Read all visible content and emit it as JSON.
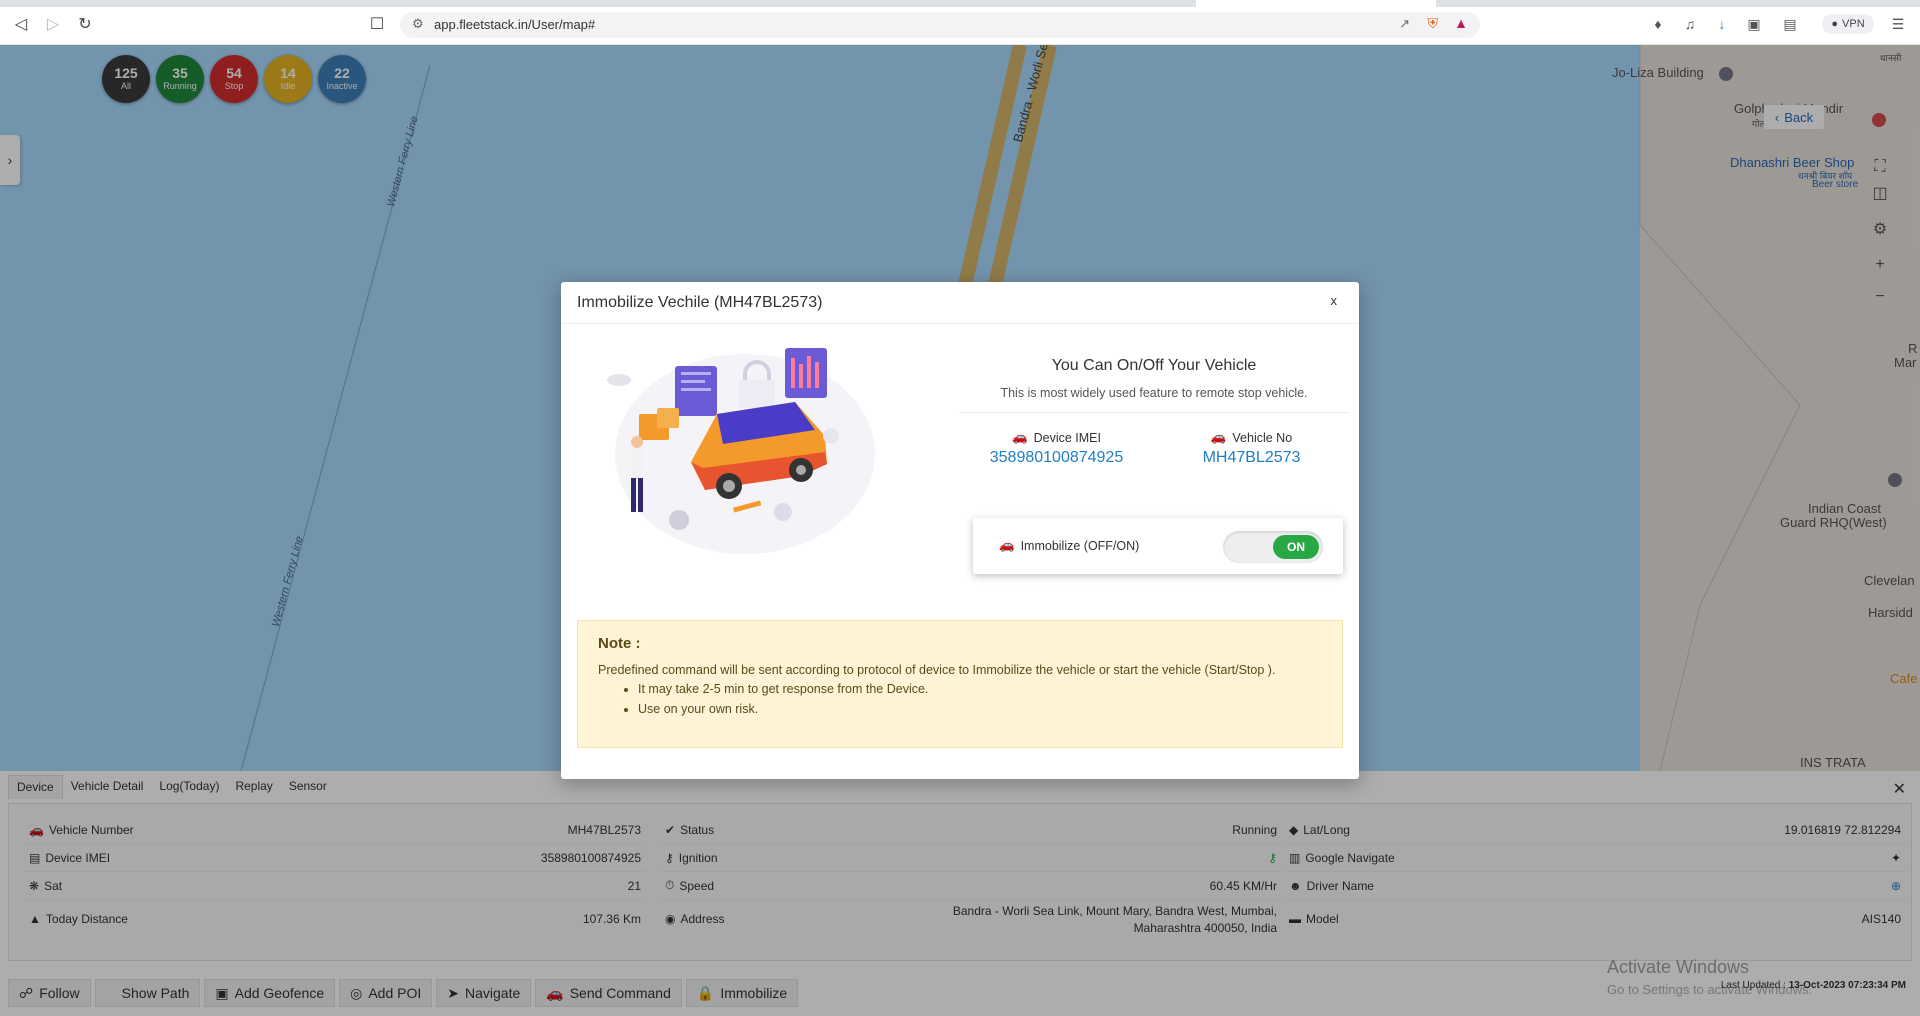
{
  "browser": {
    "url": "app.fleetstack.in/User/map#",
    "vpn_label": "VPN"
  },
  "status_counts": [
    {
      "count": "125",
      "label": "All",
      "color": "#3a3a3a"
    },
    {
      "count": "35",
      "label": "Running",
      "color": "#1f8a3b"
    },
    {
      "count": "54",
      "label": "Stop",
      "color": "#d32f2f"
    },
    {
      "count": "14",
      "label": "Idle",
      "color": "#e6b422"
    },
    {
      "count": "22",
      "label": "Inactive",
      "color": "#3d7fb8"
    }
  ],
  "map": {
    "back_label": "Back",
    "roads": [
      "Bandra - Worli Se",
      "Western Ferry Line",
      "Western Ferry Line"
    ],
    "pois": [
      "Jo-Liza Building",
      "Golphadevi Mandir",
      "गोलफादेवी मंदिर",
      "Dhanashri Beer Shop",
      "धनश्री बियर शॉप",
      "Beer store",
      "Indian Coast",
      "Guard RHQ(West)",
      "Clevelan",
      "Harsidd",
      "Cafe",
      "INS TRATA",
      "R",
      "Mar",
      "धानसी"
    ]
  },
  "modal": {
    "title": "Immobilize Vechile (MH47BL2573)",
    "close_label": "x",
    "heading": "You Can On/Off Your Vehicle",
    "subheading": "This is most widely used feature to remote stop vehicle.",
    "device_imei_label": "Device IMEI",
    "device_imei_value": "358980100874925",
    "vehicle_no_label": "Vehicle No",
    "vehicle_no_value": "MH47BL2573",
    "toggle_label": "Immobilize (OFF/ON)",
    "toggle_state": "ON",
    "note_title": "Note :",
    "note_text": "Predefined command will be sent according to protocol of device to Immobilize the vehicle or start the vehicle (Start/Stop ).",
    "note_items": [
      "It may take 2-5 min to get response from the Device.",
      "Use on your own risk."
    ]
  },
  "panel": {
    "tabs": [
      "Device",
      "Vehicle Detail",
      "Log(Today)",
      "Replay",
      "Sensor"
    ],
    "col1": [
      {
        "key": "Vehicle Number",
        "value": "MH47BL2573"
      },
      {
        "key": "Device IMEI",
        "value": "358980100874925"
      },
      {
        "key": "Sat",
        "value": "21"
      },
      {
        "key": "Today Distance",
        "value": "107.36 Km"
      }
    ],
    "col2": [
      {
        "key": "Status",
        "value": "Running"
      },
      {
        "key": "Ignition",
        "value": ""
      },
      {
        "key": "Speed",
        "value": "60.45 KM/Hr"
      },
      {
        "key": "Address",
        "value": "Bandra - Worli Sea Link, Mount Mary, Bandra West, Mumbai,",
        "value2": "Maharashtra 400050, India"
      }
    ],
    "col3": [
      {
        "key": "Lat/Long",
        "value": "19.016819 72.812294"
      },
      {
        "key": "Google Navigate",
        "value": ""
      },
      {
        "key": "Driver Name",
        "value": ""
      },
      {
        "key": "Model",
        "value": "AIS140"
      }
    ],
    "actions": [
      "Follow",
      "Show Path",
      "Add Geofence",
      "Add POI",
      "Navigate",
      "Send Command",
      "Immobilize"
    ],
    "last_updated_label": "Last Updated :",
    "last_updated_value": "13-Oct-2023 07:23:34 PM",
    "watermark_title": "Activate Windows",
    "watermark_sub": "Go to Settings to activate Windows."
  }
}
